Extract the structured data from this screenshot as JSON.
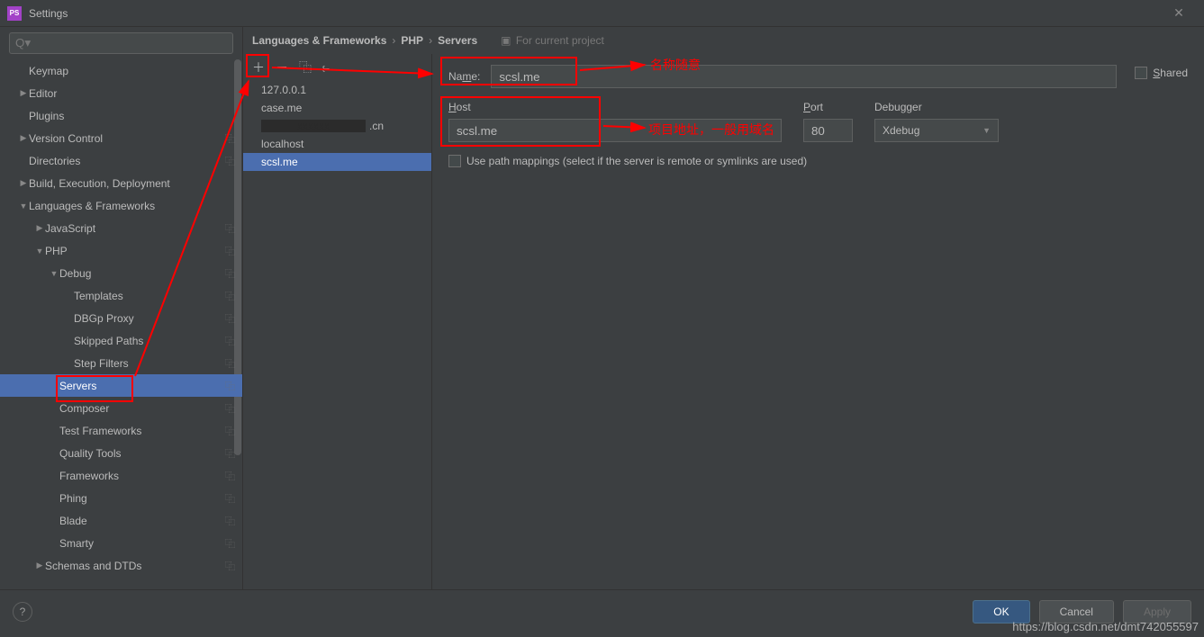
{
  "window": {
    "title": "Settings"
  },
  "search": {
    "placeholder": ""
  },
  "sidebar": {
    "items": [
      {
        "label": "Keymap",
        "lvl": 0,
        "arrow": "",
        "copy": false
      },
      {
        "label": "Editor",
        "lvl": 0,
        "arrow": "▶",
        "copy": false
      },
      {
        "label": "Plugins",
        "lvl": 0,
        "arrow": "",
        "copy": false
      },
      {
        "label": "Version Control",
        "lvl": 0,
        "arrow": "▶",
        "copy": true
      },
      {
        "label": "Directories",
        "lvl": 0,
        "arrow": "",
        "copy": true
      },
      {
        "label": "Build, Execution, Deployment",
        "lvl": 0,
        "arrow": "▶",
        "copy": false
      },
      {
        "label": "Languages & Frameworks",
        "lvl": 0,
        "arrow": "▼",
        "copy": false
      },
      {
        "label": "JavaScript",
        "lvl": 1,
        "arrow": "▶",
        "copy": true
      },
      {
        "label": "PHP",
        "lvl": 1,
        "arrow": "▼",
        "copy": true
      },
      {
        "label": "Debug",
        "lvl": 2,
        "arrow": "▼",
        "copy": true
      },
      {
        "label": "Templates",
        "lvl": 3,
        "arrow": "",
        "copy": true
      },
      {
        "label": "DBGp Proxy",
        "lvl": 3,
        "arrow": "",
        "copy": true
      },
      {
        "label": "Skipped Paths",
        "lvl": 3,
        "arrow": "",
        "copy": true
      },
      {
        "label": "Step Filters",
        "lvl": 3,
        "arrow": "",
        "copy": true
      },
      {
        "label": "Servers",
        "lvl": 2,
        "arrow": "",
        "copy": true,
        "selected": true
      },
      {
        "label": "Composer",
        "lvl": 2,
        "arrow": "",
        "copy": true
      },
      {
        "label": "Test Frameworks",
        "lvl": 2,
        "arrow": "",
        "copy": true
      },
      {
        "label": "Quality Tools",
        "lvl": 2,
        "arrow": "",
        "copy": true
      },
      {
        "label": "Frameworks",
        "lvl": 2,
        "arrow": "",
        "copy": true
      },
      {
        "label": "Phing",
        "lvl": 2,
        "arrow": "",
        "copy": true
      },
      {
        "label": "Blade",
        "lvl": 2,
        "arrow": "",
        "copy": true
      },
      {
        "label": "Smarty",
        "lvl": 2,
        "arrow": "",
        "copy": true
      },
      {
        "label": "Schemas and DTDs",
        "lvl": 1,
        "arrow": "▶",
        "copy": true
      }
    ]
  },
  "breadcrumb": {
    "a": "Languages & Frameworks",
    "b": "PHP",
    "c": "Servers",
    "hint": "For current project"
  },
  "servers": {
    "items": [
      {
        "label": "127.0.0.1"
      },
      {
        "label": "case.me"
      },
      {
        "label": ".cn",
        "masked": true
      },
      {
        "label": "localhost"
      },
      {
        "label": "scsl.me",
        "selected": true
      }
    ]
  },
  "form": {
    "name_label": "Name:",
    "name_value": "scsl.me",
    "shared_label": "Shared",
    "host_label": "Host",
    "host_value": "scsl.me",
    "port_label": "Port",
    "port_value": "80",
    "debugger_label": "Debugger",
    "debugger_value": "Xdebug",
    "mappings_label": "Use path mappings (select if the server is remote or symlinks are used)"
  },
  "footer": {
    "ok": "OK",
    "cancel": "Cancel",
    "apply": "Apply"
  },
  "annotations": {
    "name_hint": "名称随意",
    "host_hint": "项目地址，一般用域名"
  },
  "watermark": "https://blog.csdn.net/dmt742055597"
}
